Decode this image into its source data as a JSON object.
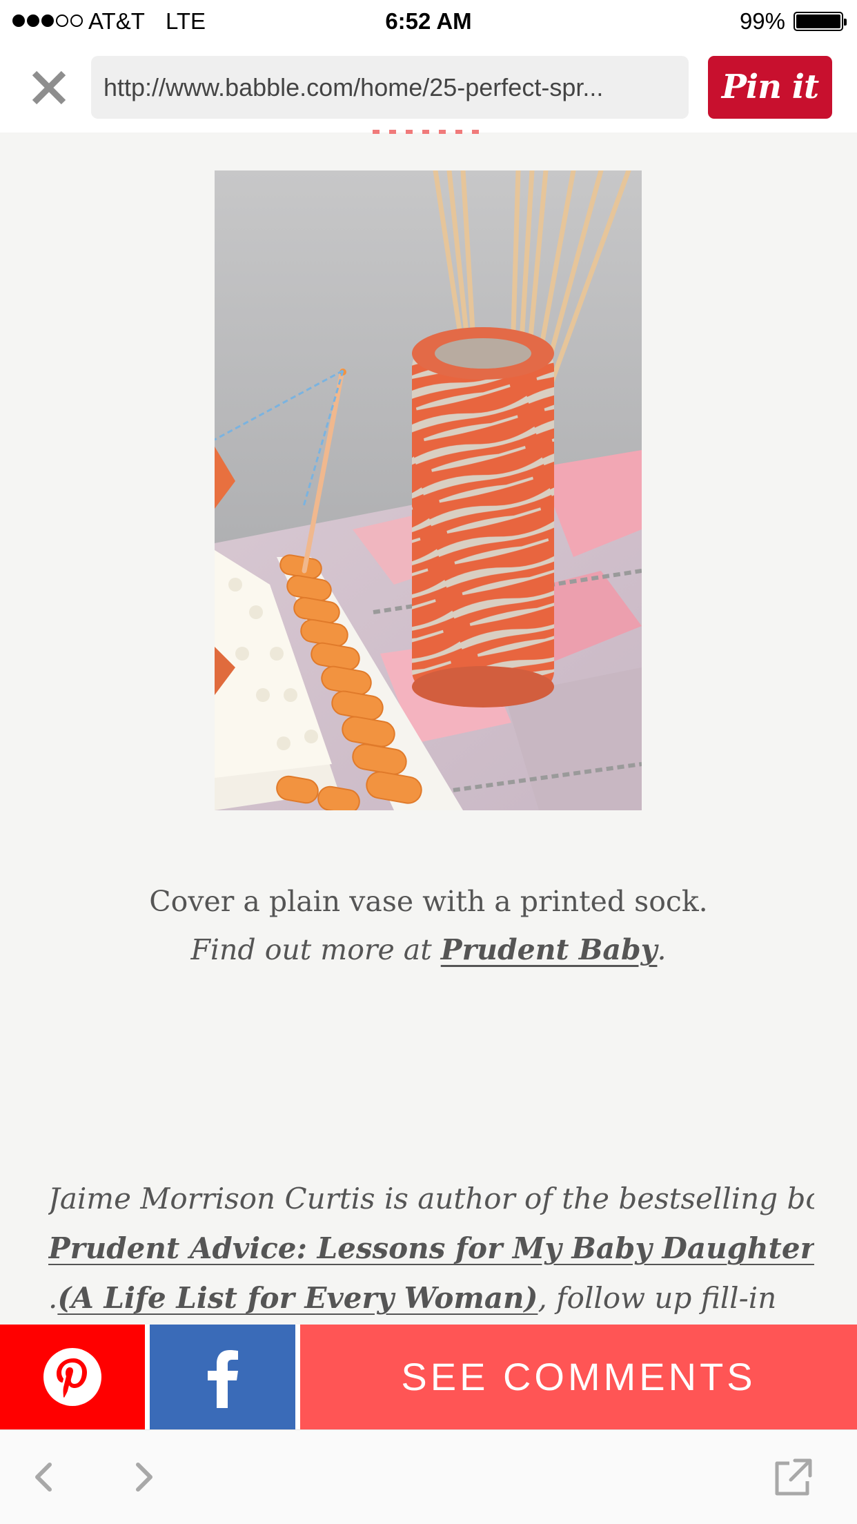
{
  "status_bar": {
    "carrier": "AT&T",
    "network": "LTE",
    "time": "6:52 AM",
    "battery_percent": "99%",
    "signal_bars": 3,
    "signal_max": 5
  },
  "browser": {
    "url": "http://www.babble.com/home/25-perfect-spr...",
    "pin_button_label": "Pin it"
  },
  "article": {
    "caption_line1": "Cover a plain vase with a printed sock.",
    "caption_line2_prefix": "Find out more at ",
    "caption_link": "Prudent Baby",
    "caption_line2_suffix": ".",
    "bio_line1": "Jaime Morrison Curtis is author of the bestselling book",
    "bio_link1": "Prudent Advice: Lessons for My Baby Daughter",
    "bio_line3_prefix": ".",
    "bio_link2": "(A Life List for Every Woman)",
    "bio_line3_suffix": ", follow up fill-in"
  },
  "share_bar": {
    "see_comments_label": "SEE COMMENTS"
  },
  "colors": {
    "pinterest_red": "#ff0000",
    "facebook_blue": "#3a6bb8",
    "comments_coral": "#ff5555",
    "pin_it_red": "#c8102e"
  },
  "icons": {
    "close": "close-icon",
    "pinterest": "pinterest-icon",
    "facebook": "facebook-icon",
    "back": "chevron-left-icon",
    "forward": "chevron-right-icon",
    "open_external": "open-external-icon"
  }
}
